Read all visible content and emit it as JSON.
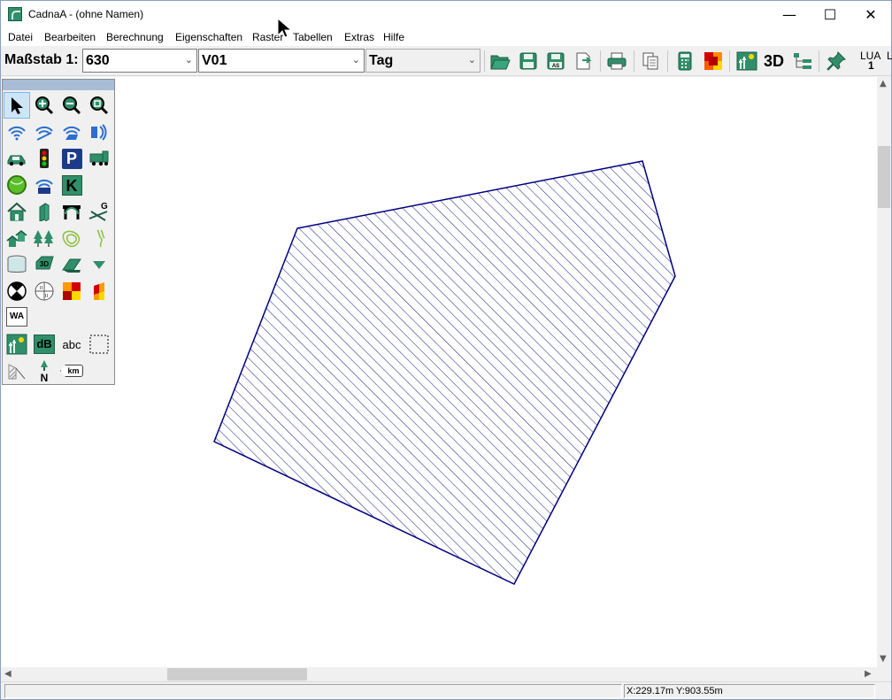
{
  "window": {
    "title": "CadnaA - (ohne Namen)",
    "min_glyph": "—",
    "max_glyph": "☐",
    "close_glyph": "✕"
  },
  "menu": [
    "Datei",
    "Bearbeiten",
    "Berechnung",
    "Eigenschaften",
    "Raster",
    "Tabellen",
    "Extras",
    "Hilfe"
  ],
  "toolbar": {
    "scale_label": "Maßstab 1:",
    "scale_value": "630",
    "variant_value": "V01",
    "period_value": "Tag",
    "three_d_label": "3D",
    "lua_label": "LUA",
    "lua_sub": "1",
    "clipped_label": "L"
  },
  "palette": {
    "wa_label": "WA",
    "db_label": "dB",
    "abc_label": "abc",
    "k_label": "K",
    "p_label": "P",
    "three_d_label": "3D",
    "north_label": "N",
    "km_label": "km",
    "g_label": "G"
  },
  "status": {
    "left_text": "",
    "coordinates": "X:229.17m Y:903.55m"
  },
  "colors": {
    "polygon_stroke": "#000080",
    "hatch": "#000080",
    "accent": "#2f8f6a"
  }
}
